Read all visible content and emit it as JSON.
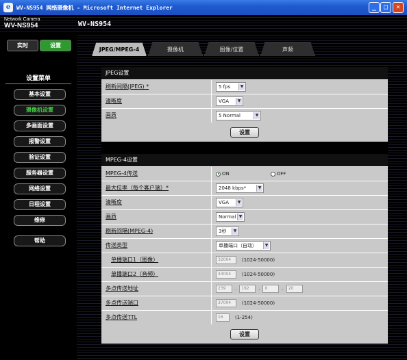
{
  "window": {
    "title": "WV-NS954 网络摄像机 - Microsoft Internet Explorer",
    "ie_icon": "e"
  },
  "header": {
    "brand_small": "Network Camera",
    "brand_big": "WV-NS954",
    "model": "WV-NS954"
  },
  "top_buttons": {
    "live": "实时",
    "setup": "设置"
  },
  "menu": {
    "title": "设置菜单",
    "items": [
      {
        "label": "基本设置",
        "active": false
      },
      {
        "label": "摄像机设置",
        "active": true
      },
      {
        "label": "多画面设置",
        "active": false
      },
      {
        "label": "报警设置",
        "active": false
      },
      {
        "label": "验证设置",
        "active": false
      },
      {
        "label": "服务器设置",
        "active": false
      },
      {
        "label": "网络设置",
        "active": false
      },
      {
        "label": "日程设置",
        "active": false
      },
      {
        "label": "维修",
        "active": false
      },
      {
        "label": "帮助",
        "active": false
      }
    ]
  },
  "tabs": [
    "JPEG/MPEG-4",
    "摄像机",
    "图像/位置",
    "声频"
  ],
  "jpeg": {
    "section": "JPEG设置",
    "interval_label": "刷新间隔(JPEG) *",
    "interval_value": "5 fps",
    "resolution_label": "清晰度",
    "resolution_value": "VGA",
    "quality_label": "画质",
    "quality_value": "5 Normal",
    "set_button": "设置"
  },
  "mpeg4": {
    "section": "MPEG-4设置",
    "transmit_label": "MPEG-4传送",
    "transmit_on": "ON",
    "transmit_off": "OFF",
    "bitrate_label": "最大位率（每个客户端）*",
    "bitrate_value": "2048 kbps*",
    "resolution_label": "清晰度",
    "resolution_value": "VGA",
    "quality_label": "画质",
    "quality_value": "Normal",
    "interval_label": "刷新间隔(MPEG-4)",
    "interval_value": "3秒",
    "transfer_label": "传送类型",
    "transfer_value": "单播端口（自动）",
    "unicast1_label": "单播端口1（图像）",
    "unicast1_value": "32004",
    "unicast1_hint": "(1024-50000)",
    "unicast2_label": "单播端口2（音频）",
    "unicast2_value": "33004",
    "unicast2_hint": "(1024-50000)",
    "multicast_addr_label": "多点传送地址",
    "multicast_addr": [
      "239",
      "192",
      "0",
      "20"
    ],
    "multicast_port_label": "多点传送端口",
    "multicast_port_value": "37004",
    "multicast_port_hint": "(1024-50000)",
    "multicast_ttl_label": "多点传送TTL",
    "multicast_ttl_value": "16",
    "multicast_ttl_hint": "(1-254)",
    "set_button": "设置"
  }
}
